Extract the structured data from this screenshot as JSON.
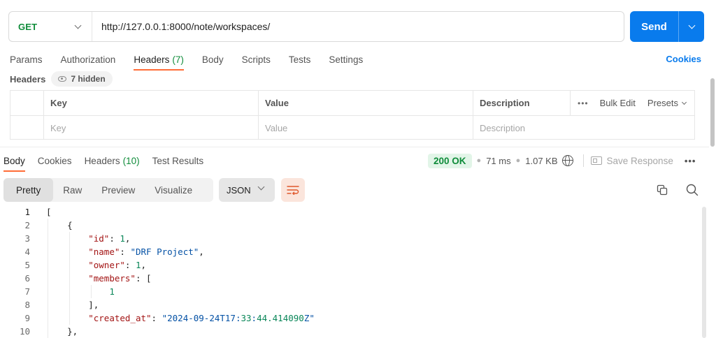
{
  "request": {
    "method": "GET",
    "url": "http://127.0.0.1:8000/note/workspaces/",
    "send_label": "Send"
  },
  "request_tabs": [
    {
      "label": "Params"
    },
    {
      "label": "Authorization"
    },
    {
      "label": "Headers",
      "count": "(7)"
    },
    {
      "label": "Body"
    },
    {
      "label": "Scripts"
    },
    {
      "label": "Tests"
    },
    {
      "label": "Settings"
    }
  ],
  "cookies_link": "Cookies",
  "headers_section": {
    "title": "Headers",
    "hidden_label": "7 hidden",
    "columns": [
      "Key",
      "Value",
      "Description"
    ],
    "more_label": "•••",
    "bulk_edit": "Bulk Edit",
    "presets": "Presets",
    "placeholders": {
      "key": "Key",
      "value": "Value",
      "description": "Description"
    }
  },
  "response_tabs": [
    {
      "label": "Body"
    },
    {
      "label": "Cookies"
    },
    {
      "label": "Headers",
      "count": "(10)"
    },
    {
      "label": "Test Results"
    }
  ],
  "response_meta": {
    "status": "200 OK",
    "time": "71 ms",
    "size": "1.07 KB",
    "save_label": "Save Response",
    "more": "•••"
  },
  "format_tabs": [
    "Pretty",
    "Raw",
    "Preview",
    "Visualize"
  ],
  "format_select": "JSON",
  "code_lines": [
    {
      "n": "1",
      "t": "["
    },
    {
      "n": "2",
      "t": "    {"
    },
    {
      "n": "3",
      "t": "        \"id\": 1,"
    },
    {
      "n": "4",
      "t": "        \"name\": \"DRF Project\","
    },
    {
      "n": "5",
      "t": "        \"owner\": 1,"
    },
    {
      "n": "6",
      "t": "        \"members\": ["
    },
    {
      "n": "7",
      "t": "            1"
    },
    {
      "n": "8",
      "t": "        ],"
    },
    {
      "n": "9",
      "t": "        \"created_at\": \"2024-09-24T17:33:44.414090Z\""
    },
    {
      "n": "10",
      "t": "    },"
    }
  ],
  "colors": {
    "accent": "#ff6c37",
    "send": "#097bed",
    "method": "#0f8c3a",
    "json_key": "#a31515",
    "json_string": "#0451a5",
    "json_number": "#098658"
  }
}
